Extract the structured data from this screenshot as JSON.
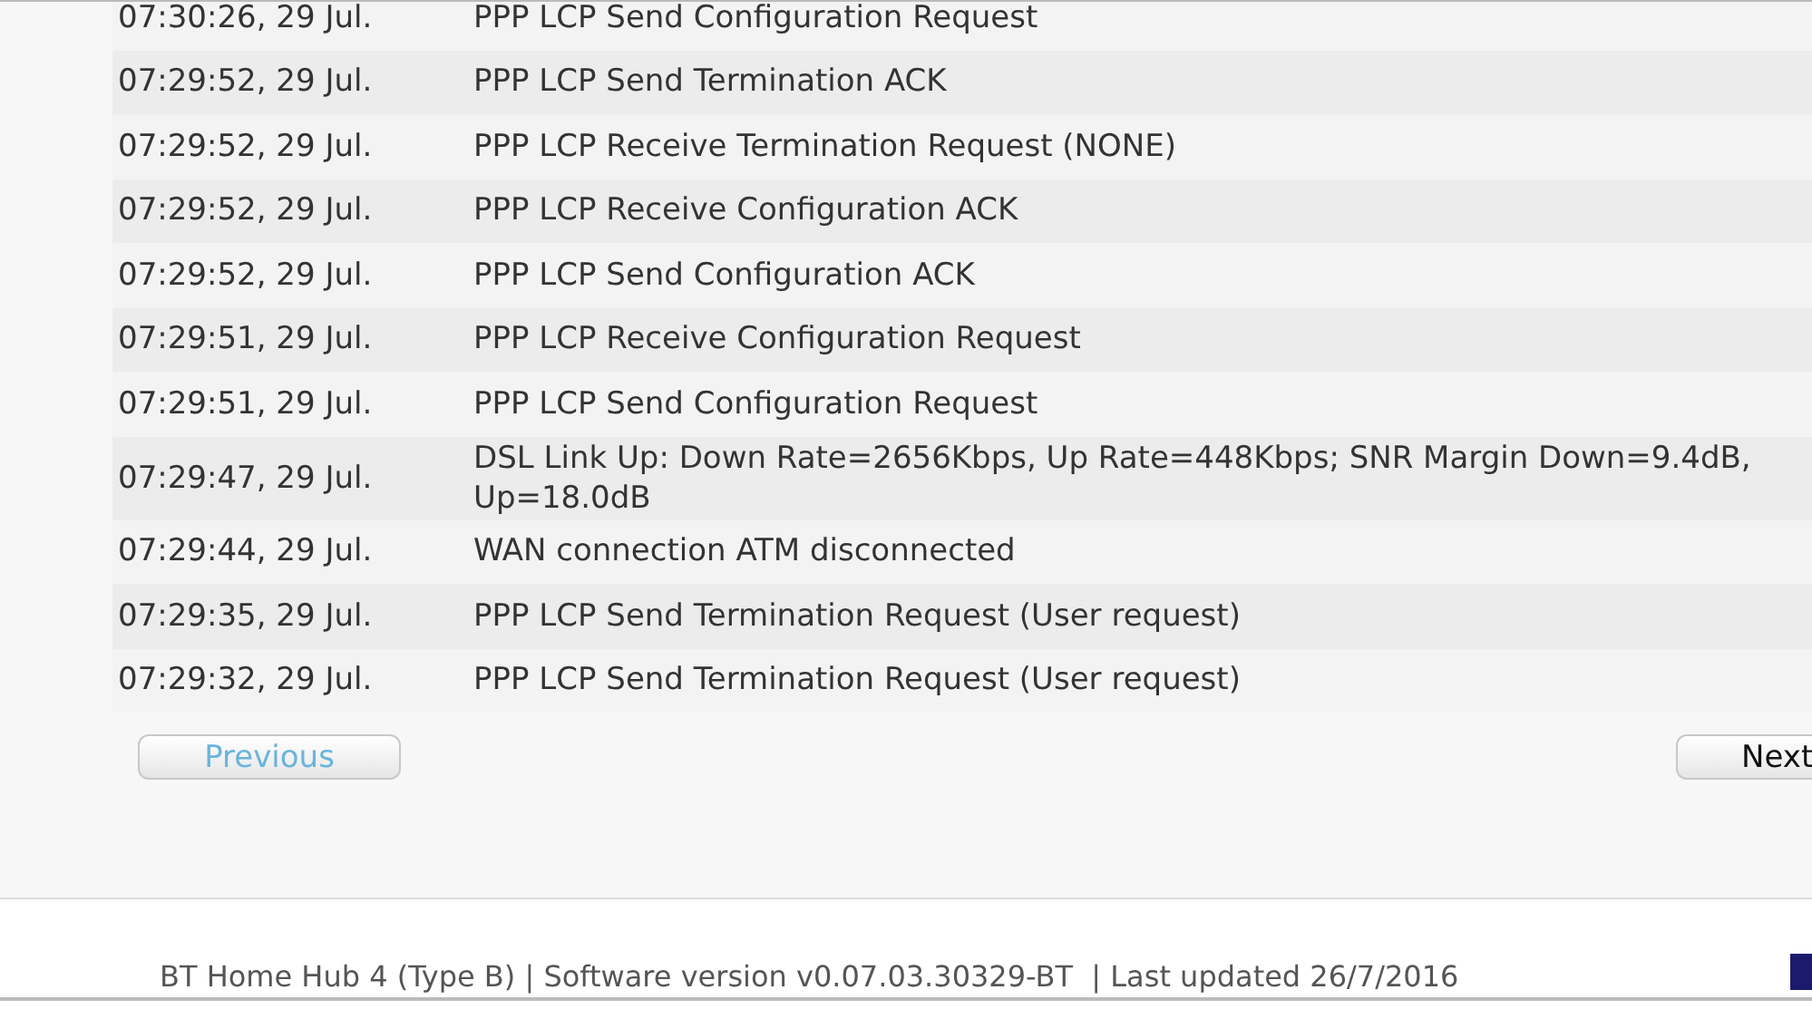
{
  "log": {
    "rows": [
      {
        "time": "07:30:26, 29 Jul.",
        "event": "PPP LCP Send Configuration Request"
      },
      {
        "time": "07:29:52, 29 Jul.",
        "event": "PPP LCP Send Termination ACK"
      },
      {
        "time": "07:29:52, 29 Jul.",
        "event": "PPP LCP Receive Termination Request (NONE)"
      },
      {
        "time": "07:29:52, 29 Jul.",
        "event": "PPP LCP Receive Configuration ACK"
      },
      {
        "time": "07:29:52, 29 Jul.",
        "event": "PPP LCP Send Configuration ACK"
      },
      {
        "time": "07:29:51, 29 Jul.",
        "event": "PPP LCP Receive Configuration Request"
      },
      {
        "time": "07:29:51, 29 Jul.",
        "event": "PPP LCP Send Configuration Request"
      },
      {
        "time": "07:29:47, 29 Jul.",
        "event": "DSL Link Up: Down Rate=2656Kbps, Up Rate=448Kbps; SNR Margin Down=9.4dB, Up=18.0dB"
      },
      {
        "time": "07:29:44, 29 Jul.",
        "event": "WAN connection ATM disconnected"
      },
      {
        "time": "07:29:35, 29 Jul.",
        "event": "PPP LCP Send Termination Request (User request)"
      },
      {
        "time": "07:29:32, 29 Jul.",
        "event": "PPP LCP Send Termination Request (User request)"
      }
    ]
  },
  "pager": {
    "previous": {
      "label": "Previous",
      "disabled": true
    },
    "next": {
      "label": "Next",
      "disabled": false
    }
  },
  "footer": {
    "text": "BT Home Hub 4 (Type B) | Software version v0.07.03.30329-BT  | Last updated 26/7/2016"
  }
}
